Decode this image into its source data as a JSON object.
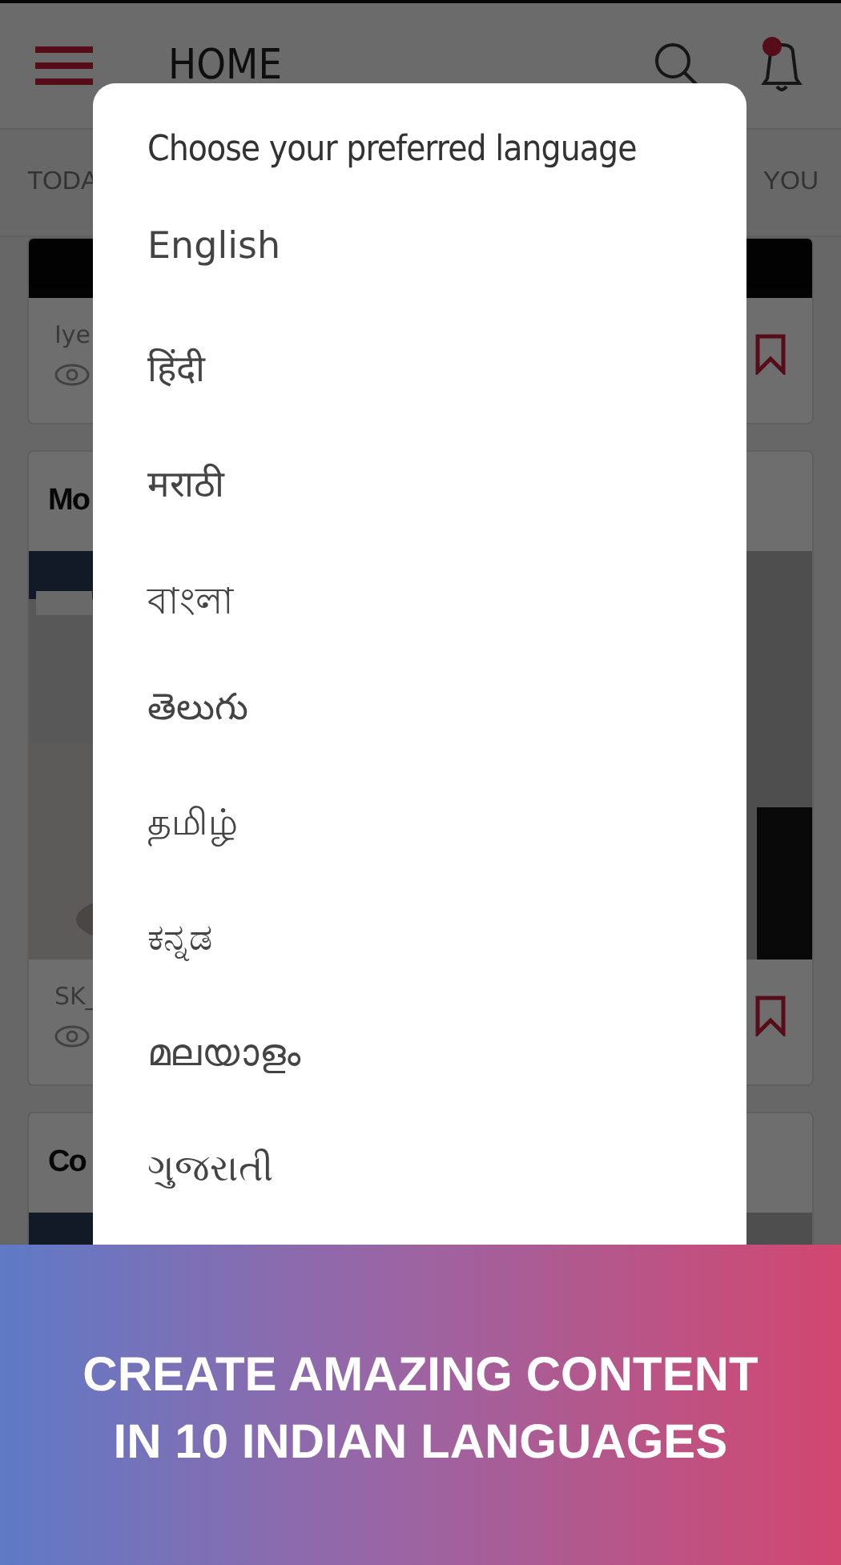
{
  "header": {
    "title": "HOME"
  },
  "tabs": [
    {
      "label": "TODA"
    },
    {
      "label": "YOU"
    }
  ],
  "cards": [
    {
      "author": "Iye"
    },
    {
      "title": "Mo",
      "author": "SK_"
    },
    {
      "title": "Co"
    }
  ],
  "dialog": {
    "title": "Choose your preferred language",
    "options": [
      "English",
      "हिंदी",
      "मराठी",
      "বাংলা",
      "తెలుగు",
      "தமிழ்",
      "ಕನ್ನಡ",
      "മലയാളം",
      "ગુજરાતી"
    ]
  },
  "banner": {
    "lines": [
      "CREATE AMAZING CONTENT",
      "IN 10 INDIAN LANGUAGES"
    ]
  }
}
